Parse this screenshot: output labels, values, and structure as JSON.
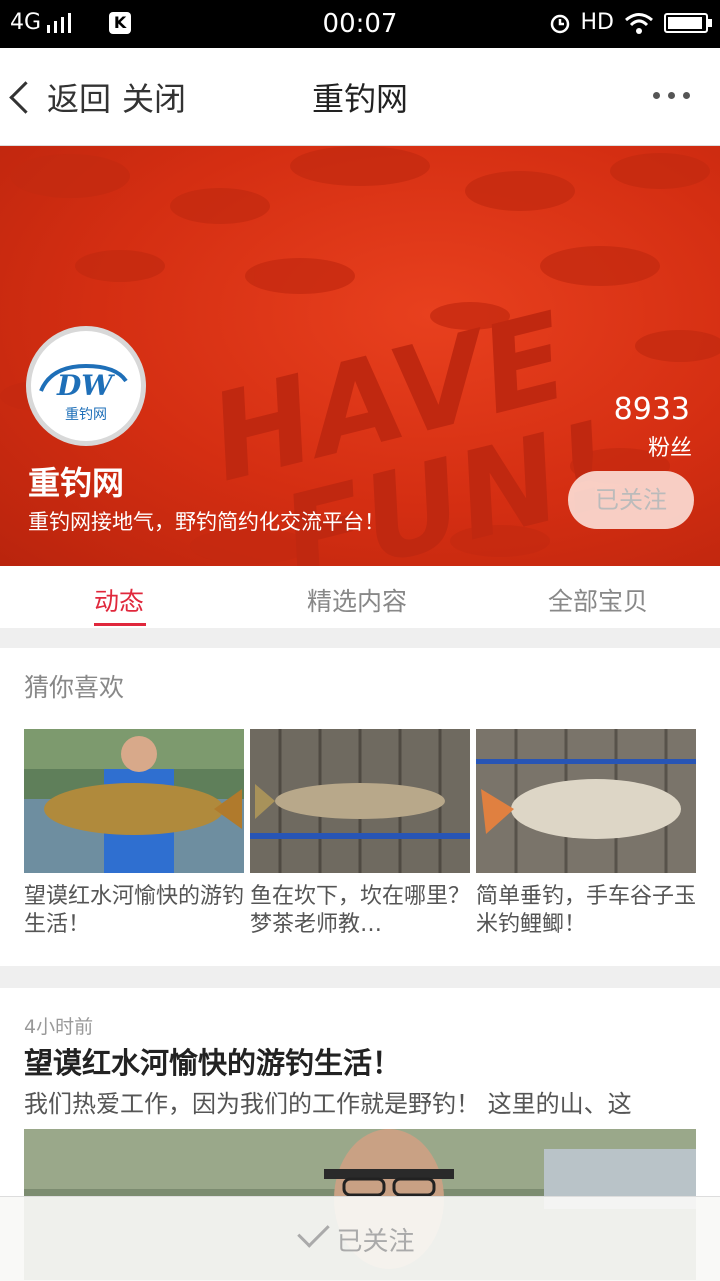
{
  "status_bar": {
    "network": "4G",
    "time": "00:07",
    "hd": "HD",
    "icons": [
      "signal-icon",
      "k-app-icon",
      "alarm-icon",
      "wifi-icon",
      "battery-icon"
    ]
  },
  "nav": {
    "back_label": "返回",
    "close_label": "关闭",
    "title": "重钓网",
    "more_icon": "more-dots-icon"
  },
  "profile": {
    "logo_text": "DW",
    "logo_subtext": "重钓网",
    "name": "重钓网",
    "description": "重钓网接地气，野钓简约化交流平台！",
    "fans_count": "8933",
    "fans_label": "粉丝",
    "follow_state": "已关注",
    "banner_text": [
      "HAVE",
      "FUN!"
    ]
  },
  "tabs": [
    {
      "label": "动态",
      "active": true
    },
    {
      "label": "精选内容",
      "active": false
    },
    {
      "label": "全部宝贝",
      "active": false
    }
  ],
  "recommend": {
    "title": "猜你喜欢",
    "items": [
      {
        "caption": "望谟红水河愉快的游钓生活！"
      },
      {
        "caption": "鱼在坎下，坎在哪里？梦茶老师教…"
      },
      {
        "caption": "简单垂钓，手车谷子玉米钓鲤鲫！"
      }
    ]
  },
  "feed": {
    "time": "4小时前",
    "title": "望谟红水河愉快的游钓生活！",
    "body": "我们热爱工作，因为我们的工作就是野钓！ 这里的山、这"
  },
  "bottom": {
    "follow_label": "已关注"
  },
  "colors": {
    "accent": "#e0283c",
    "banner": "#d42e12"
  }
}
